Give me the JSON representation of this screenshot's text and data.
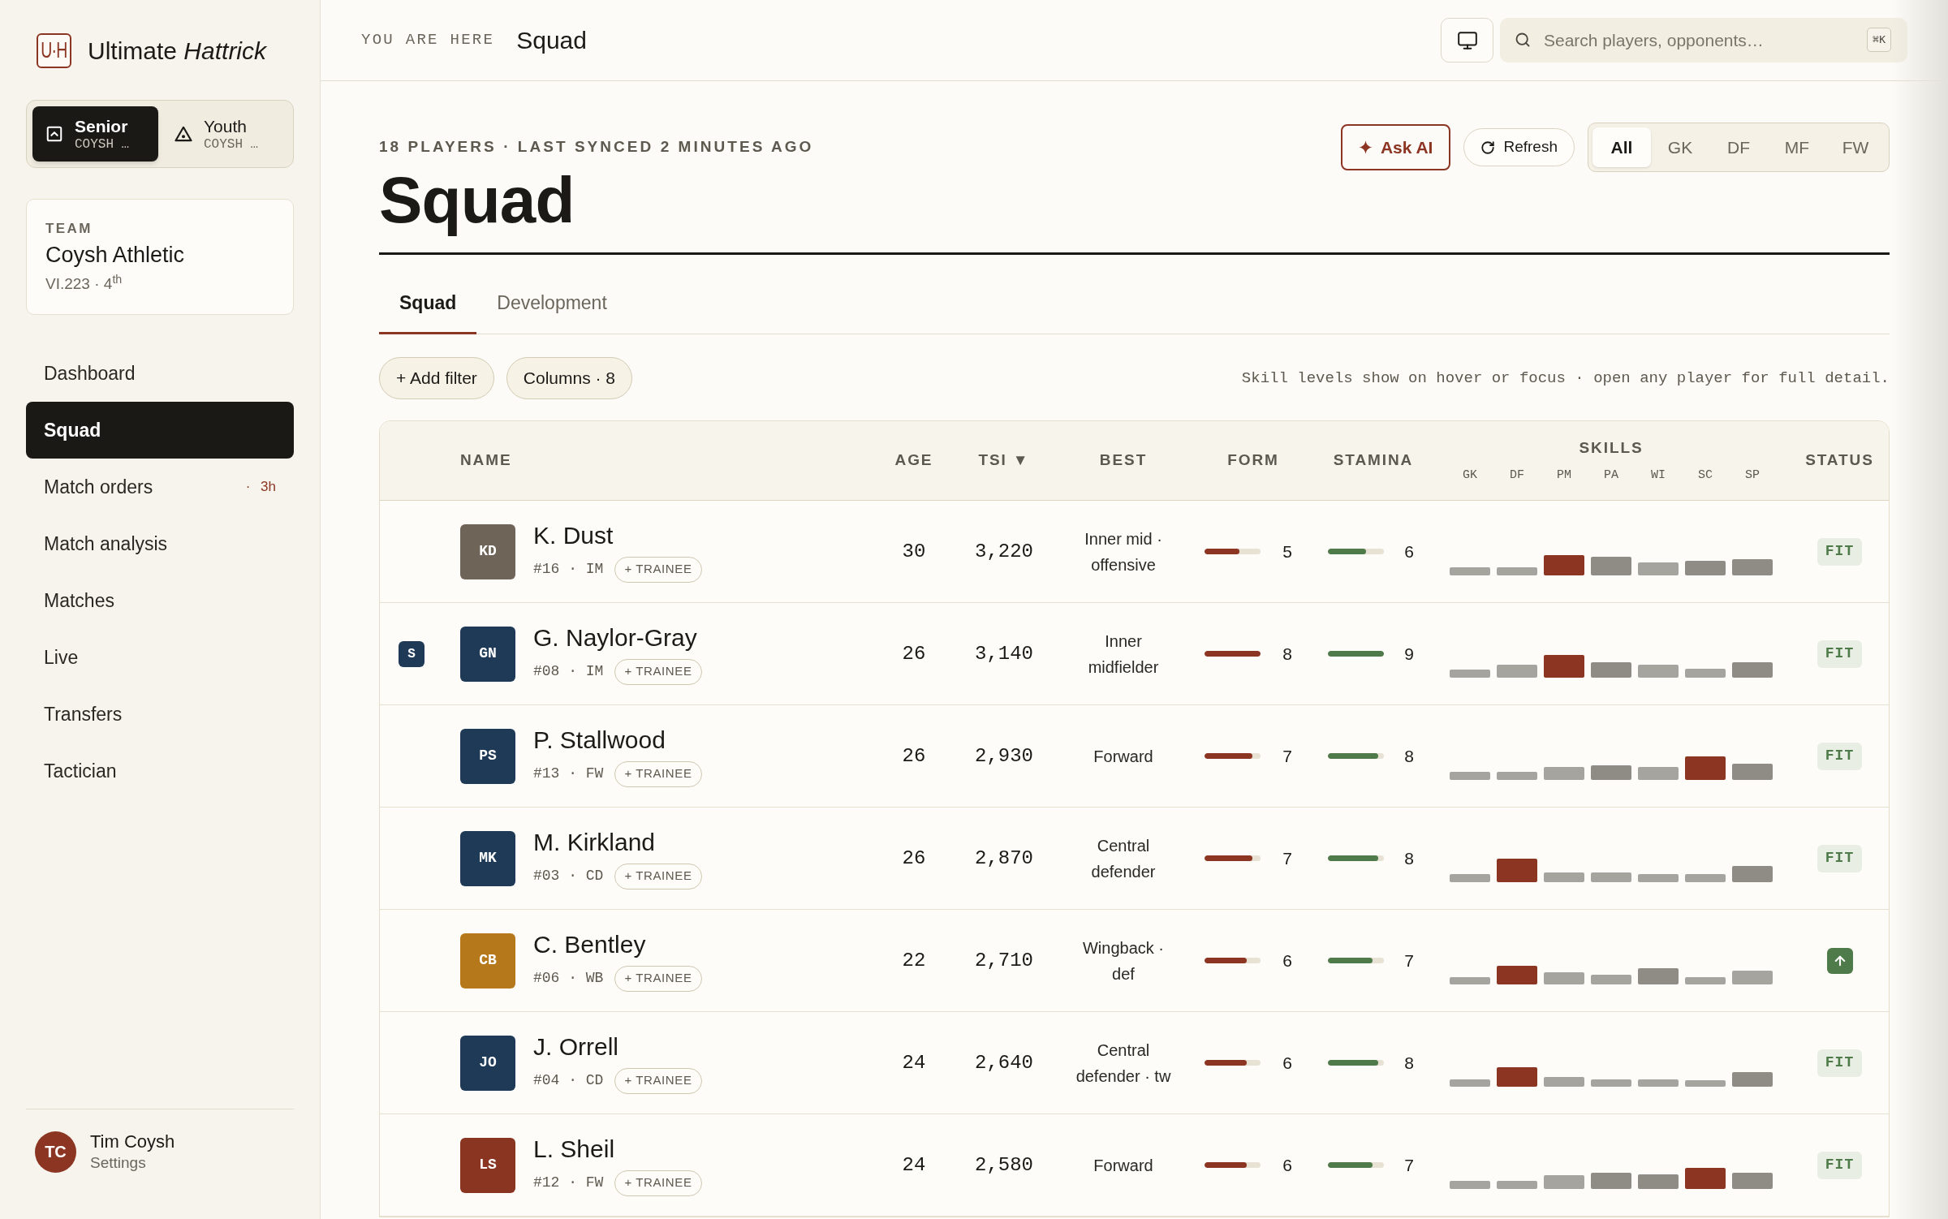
{
  "sidebar": {
    "logo": {
      "mark": "U·H",
      "name": "Ultimate *Hattrick*"
    },
    "team_switch": [
      {
        "kind": "senior",
        "label": "Senior",
        "sub": "COYSH …",
        "selected": true
      },
      {
        "kind": "youth",
        "label": "Youth",
        "sub": "COYSH …",
        "selected": false
      }
    ],
    "team_card": {
      "caption": "TEAM",
      "name": "Coysh Athletic",
      "meta": "VI.223 · 4$^{th}$"
    },
    "nav": [
      {
        "label": "Dashboard",
        "selected": false
      },
      {
        "label": "Squad",
        "selected": true
      },
      {
        "label": "Match orders",
        "selected": false,
        "badge": "· 3h"
      },
      {
        "label": "Match analysis",
        "selected": false
      },
      {
        "label": "Matches",
        "selected": false
      },
      {
        "label": "Live",
        "selected": false
      },
      {
        "label": "Transfers",
        "selected": false
      },
      {
        "label": "Tactician",
        "selected": false
      }
    ],
    "user": {
      "initials": "TC",
      "name": "Tim Coysh",
      "link": "Settings"
    }
  },
  "top_bar": {
    "breadcrumb_label": "YOU ARE HERE",
    "current": "Squad",
    "search": {
      "placeholder": "Search players, opponents…",
      "shortcut": "⌘K"
    }
  },
  "header": {
    "meta": "18 PLAYERS · LAST SYNCED 2 MINUTES AGO",
    "title": "Squad",
    "actions": [
      {
        "kind": "ai",
        "label": "Ask AI"
      },
      {
        "kind": "refresh",
        "label": "Refresh"
      }
    ],
    "position_filter": [
      {
        "label": "All",
        "selected": true
      },
      {
        "label": "GK",
        "selected": false
      },
      {
        "label": "DF",
        "selected": false
      },
      {
        "label": "MF",
        "selected": false
      },
      {
        "label": "FW",
        "selected": false
      }
    ]
  },
  "tabs": [
    {
      "label": "Squad",
      "selected": true
    },
    {
      "label": "Development",
      "selected": false
    }
  ],
  "toolbar": {
    "filters": [
      "+ Add filter",
      "Columns · 8"
    ],
    "hint": "Skill levels show on hover or focus · open any player for full detail."
  },
  "table": {
    "columns": [
      "NAME",
      "AGE",
      "TSI ▼",
      "BEST",
      "FORM",
      "STAMINA",
      "SKILLS",
      "STATUS"
    ],
    "skill_columns": [
      "GK",
      "DF",
      "PM",
      "PA",
      "WI",
      "SC",
      "SP"
    ],
    "rows": [
      {
        "avatar": {
          "initials": "KD",
          "color": "#6e6458"
        },
        "name": "K. Dust",
        "meta": "#16 · IM",
        "action": "+ TRAINEE",
        "age": "30",
        "tsi": "3,220",
        "best": "Inner mid · offensive",
        "form": {
          "value": "5",
          "level": 0.63
        },
        "stamina": {
          "value": "6",
          "level": 0.68
        },
        "skills": [
          {
            "highlight": false
          },
          {
            "highlight": false
          },
          {
            "highlight": true
          },
          {
            "highlight": false
          },
          {
            "highlight": false
          },
          {
            "highlight": false
          },
          {
            "highlight": false
          }
        ],
        "status": {
          "kind": "tag",
          "label": "FIT"
        }
      },
      {
        "marker": "S",
        "avatar": {
          "initials": "GN",
          "color": "#1e3a56"
        },
        "name": "G. Naylor-Gray",
        "meta": "#08 · IM",
        "action": "+ TRAINEE",
        "age": "26",
        "tsi": "3,140",
        "best": "Inner midfielder",
        "form": {
          "value": "8",
          "level": 1
        },
        "stamina": {
          "value": "9",
          "level": 1
        },
        "skills": [
          {
            "highlight": false
          },
          {
            "highlight": false
          },
          {
            "highlight": true
          },
          {
            "highlight": false
          },
          {
            "highlight": false
          },
          {
            "highlight": false
          },
          {
            "highlight": false
          }
        ],
        "status": {
          "kind": "tag",
          "label": "FIT"
        }
      },
      {
        "avatar": {
          "initials": "PS",
          "color": "#1e3a56"
        },
        "name": "P. Stallwood",
        "meta": "#13 · FW",
        "action": "+ TRAINEE",
        "age": "26",
        "tsi": "2,930",
        "best": "Forward",
        "form": {
          "value": "7",
          "level": 0.86
        },
        "stamina": {
          "value": "8",
          "level": 0.9
        },
        "skills": [
          {
            "highlight": false
          },
          {
            "highlight": false
          },
          {
            "highlight": false
          },
          {
            "highlight": false
          },
          {
            "highlight": false
          },
          {
            "highlight": true
          },
          {
            "highlight": false
          }
        ],
        "status": {
          "kind": "tag",
          "label": "FIT"
        }
      },
      {
        "avatar": {
          "initials": "MK",
          "color": "#1e3a56"
        },
        "name": "M. Kirkland",
        "meta": "#03 · CD",
        "action": "+ TRAINEE",
        "age": "26",
        "tsi": "2,870",
        "best": "Central defender",
        "form": {
          "value": "7",
          "level": 0.86
        },
        "stamina": {
          "value": "8",
          "level": 0.9
        },
        "skills": [
          {
            "highlight": false
          },
          {
            "highlight": true
          },
          {
            "highlight": false
          },
          {
            "highlight": false
          },
          {
            "highlight": false
          },
          {
            "highlight": false
          },
          {
            "highlight": false
          }
        ],
        "status": {
          "kind": "tag",
          "label": "FIT"
        }
      },
      {
        "avatar": {
          "initials": "CB",
          "color": "#b5791b"
        },
        "name": "C. Bentley",
        "meta": "#06 · WB",
        "action": "+ TRAINEE",
        "age": "22",
        "tsi": "2,710",
        "best": "Wingback · def",
        "form": {
          "value": "6",
          "level": 0.76
        },
        "stamina": {
          "value": "7",
          "level": 0.8
        },
        "skills": [
          {
            "highlight": false
          },
          {
            "highlight": true
          },
          {
            "highlight": false
          },
          {
            "highlight": false
          },
          {
            "highlight": false
          },
          {
            "highlight": false
          },
          {
            "highlight": false
          }
        ],
        "status": {
          "kind": "rising"
        }
      },
      {
        "avatar": {
          "initials": "JO",
          "color": "#1e3a56"
        },
        "name": "J. Orrell",
        "meta": "#04 · CD",
        "action": "+ TRAINEE",
        "age": "24",
        "tsi": "2,640",
        "best": "Central defender · tw",
        "form": {
          "value": "6",
          "level": 0.76
        },
        "stamina": {
          "value": "8",
          "level": 0.9
        },
        "skills": [
          {
            "highlight": false
          },
          {
            "highlight": true
          },
          {
            "highlight": false
          },
          {
            "highlight": false
          },
          {
            "highlight": false
          },
          {
            "highlight": false
          },
          {
            "highlight": false
          }
        ],
        "status": {
          "kind": "tag",
          "label": "FIT"
        }
      },
      {
        "avatar": {
          "initials": "LS",
          "color": "#8a3522"
        },
        "name": "L. Sheil",
        "meta": "#12 · FW",
        "action": "+ TRAINEE",
        "age": "24",
        "tsi": "2,580",
        "best": "Forward",
        "form": {
          "value": "6",
          "level": 0.76
        },
        "stamina": {
          "value": "7",
          "level": 0.8
        },
        "skills": [
          {
            "highlight": false
          },
          {
            "highlight": false
          },
          {
            "highlight": false
          },
          {
            "highlight": false
          },
          {
            "highlight": false
          },
          {
            "highlight": true
          },
          {
            "highlight": false
          }
        ],
        "status": {
          "kind": "tag",
          "label": "FIT"
        }
      }
    ]
  }
}
